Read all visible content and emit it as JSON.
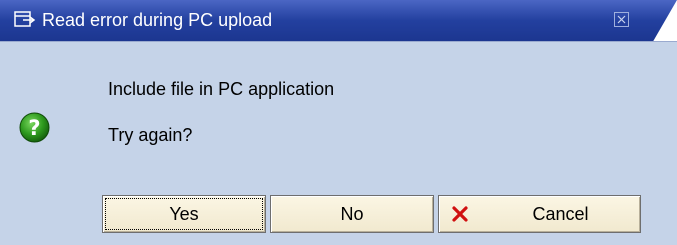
{
  "dialog": {
    "title": "Read error during PC upload",
    "messages": [
      "Include file in PC application",
      "Try again?"
    ],
    "buttons": {
      "yes": "Yes",
      "no": "No",
      "cancel": "Cancel"
    },
    "icons": {
      "title": "window-icon",
      "message": "question-help-icon",
      "close": "close-icon",
      "cancel": "red-x-icon"
    },
    "colors": {
      "titlebar": "#23409f",
      "body": "#c5d3e8",
      "button": "#f1e9cf",
      "help_icon": "#2e9a1e",
      "cancel_icon": "#d01010"
    }
  }
}
